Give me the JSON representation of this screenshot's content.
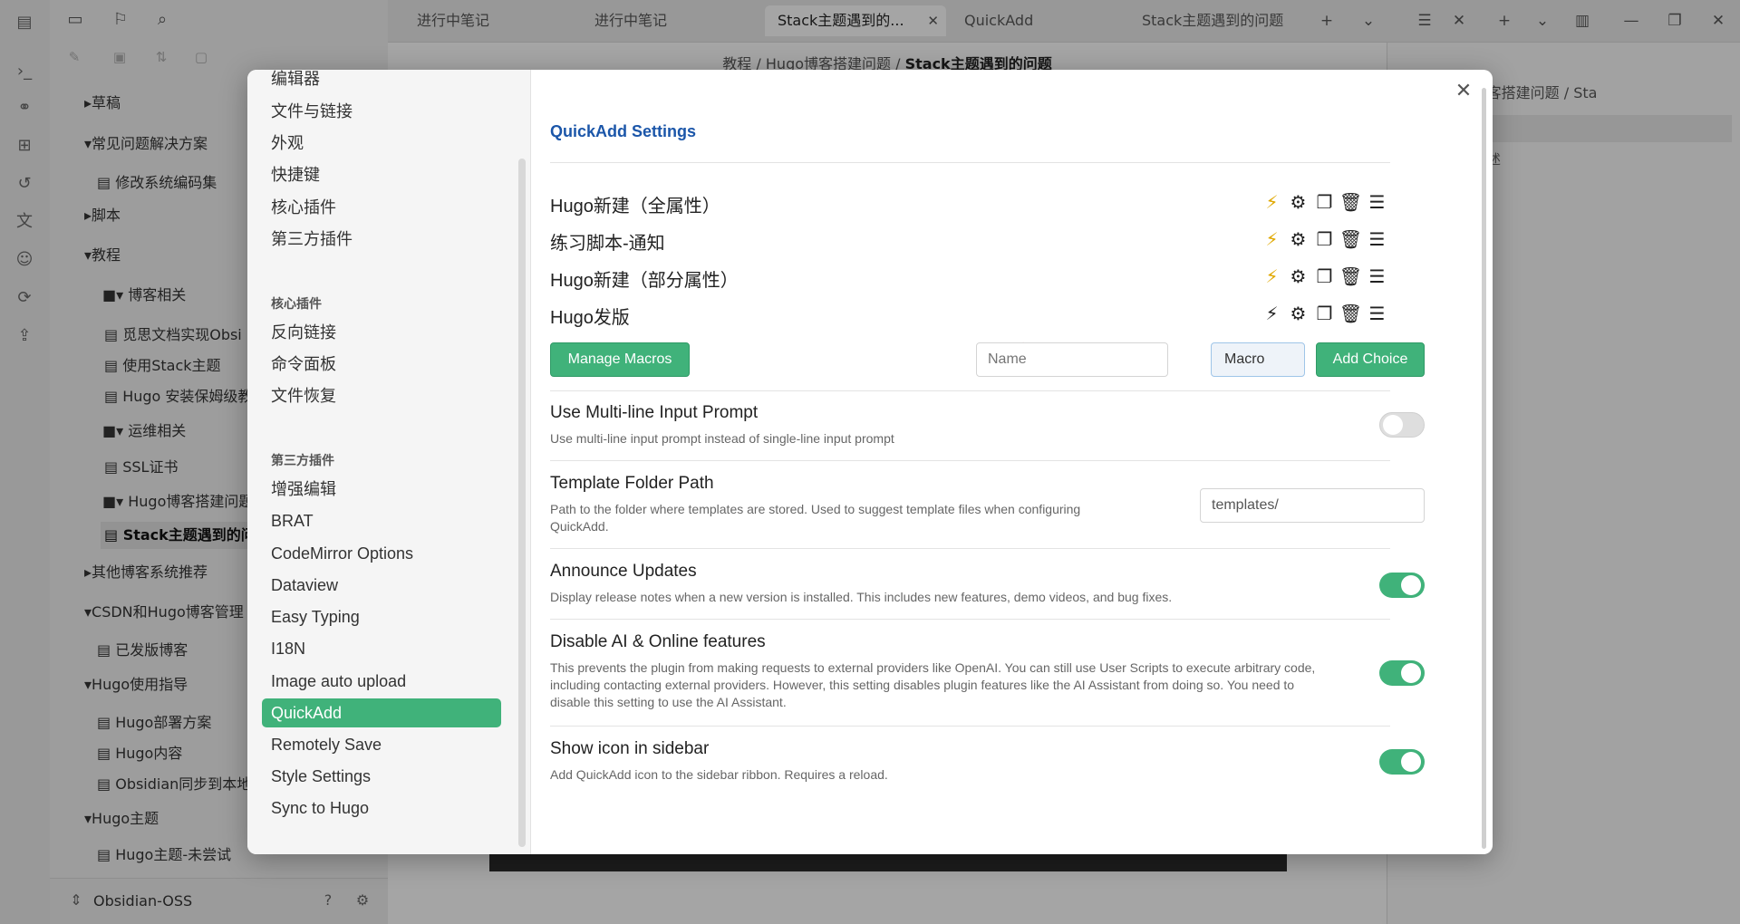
{
  "app": {
    "tabs": [
      {
        "label": "进行中笔记"
      },
      {
        "label": "进行中笔记"
      },
      {
        "label": "Stack主题遇到的..."
      },
      {
        "label": "QuickAdd"
      },
      {
        "label": "Stack主题遇到的问题"
      }
    ],
    "breadcrumb": {
      "part1": "教程",
      "sep": "/",
      "part2": "Hugo博客搭建问题",
      "current": "Stack主题遇到的问题"
    },
    "right_breadcrumb": "程 / Hugo博客搭建问题 / Sta",
    "right_text": "述",
    "vault_name": "Obsidian-OSS",
    "file_tree": [
      {
        "label": "▸草稿"
      },
      {
        "label": "▾常见问题解决方案"
      },
      {
        "label": "修改系统编码集"
      },
      {
        "label": "▸脚本"
      },
      {
        "label": "▾教程"
      },
      {
        "label": "▾ 博客相关"
      },
      {
        "label": "觅思文档实现Obsi"
      },
      {
        "label": "使用Stack主题"
      },
      {
        "label": "Hugo 安装保姆级教"
      },
      {
        "label": "▾ 运维相关"
      },
      {
        "label": "SSL证书"
      },
      {
        "label": "▾ Hugo博客搭建问题"
      },
      {
        "label": "Stack主题遇到的问题"
      },
      {
        "label": "▸其他博客系统推荐"
      },
      {
        "label": "▾CSDN和Hugo博客管理"
      },
      {
        "label": "已发版博客"
      },
      {
        "label": "▾Hugo使用指导"
      },
      {
        "label": "Hugo部署方案"
      },
      {
        "label": "Hugo内容"
      },
      {
        "label": "Obsidian同步到本地"
      },
      {
        "label": "▾Hugo主题"
      },
      {
        "label": "Hugo主题-未尝试"
      }
    ]
  },
  "settings_nav": {
    "top_items": [
      "编辑器",
      "文件与链接",
      "外观",
      "快捷键",
      "核心插件",
      "第三方插件"
    ],
    "core_header": "核心插件",
    "core_items": [
      "反向链接",
      "命令面板",
      "文件恢复"
    ],
    "community_header": "第三方插件",
    "community_items": [
      "增强编辑",
      "BRAT",
      "CodeMirror Options",
      "Dataview",
      "Easy Typing",
      "I18N",
      "Image auto upload",
      "QuickAdd",
      "Remotely Save",
      "Style Settings",
      "Sync to Hugo"
    ],
    "active": "QuickAdd"
  },
  "quickadd": {
    "title": "QuickAdd Settings",
    "choices": [
      {
        "name": "Hugo新建（全属性）"
      },
      {
        "name": "练习脚本-通知"
      },
      {
        "name": "Hugo新建（部分属性）"
      },
      {
        "name": "Hugo发版"
      }
    ],
    "manage_macros_label": "Manage Macros",
    "name_placeholder": "Name",
    "type_select_value": "Macro",
    "add_choice_label": "Add Choice",
    "settings": {
      "multiline": {
        "name": "Use Multi-line Input Prompt",
        "desc": "Use multi-line input prompt instead of single-line input prompt",
        "enabled": false
      },
      "template_folder": {
        "name": "Template Folder Path",
        "desc": "Path to the folder where templates are stored. Used to suggest template files when configuring QuickAdd.",
        "value": "templates/"
      },
      "announce": {
        "name": "Announce Updates",
        "desc": "Display release notes when a new version is installed. This includes new features, demo videos, and bug fixes.",
        "enabled": true
      },
      "disable_ai": {
        "name": "Disable AI & Online features",
        "desc": "This prevents the plugin from making requests to external providers like OpenAI. You can still use User Scripts to execute arbitrary code, including contacting external providers. However, this setting disables plugin features like the AI Assistant from doing so. You need to disable this setting to use the AI Assistant.",
        "enabled": true
      },
      "sidebar_icon": {
        "name": "Show icon in sidebar",
        "desc": "Add QuickAdd icon to the sidebar ribbon. Requires a reload.",
        "enabled": true
      }
    }
  },
  "colors": {
    "accent": "#40b27a",
    "title_blue": "#1b56a9",
    "annotation_arrow": "#e02020"
  }
}
